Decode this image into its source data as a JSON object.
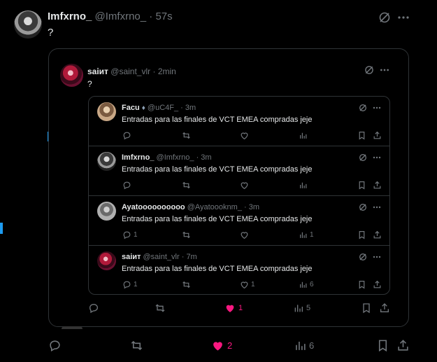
{
  "tweet": {
    "display_name": "Imfxrno_",
    "handle": "@Imfxrno_",
    "time": "· 57s",
    "text": "?",
    "actions": {
      "replies": "",
      "retweets": "",
      "likes": "2",
      "views": "6"
    }
  },
  "quote": {
    "display_name": "saiит",
    "handle": "@saint_vlr",
    "time": "· 2min",
    "text": "?",
    "actions": {
      "replies": "",
      "retweets": "",
      "likes": "1",
      "views": "5"
    }
  },
  "replies": [
    {
      "display_name": "Facu",
      "handle": "@uC4F_",
      "time": "· 3m",
      "text": "Entradas para las finales de VCT EMEA compradas jeje",
      "counts": {
        "replies": "",
        "retweets": "",
        "likes": "",
        "views": ""
      }
    },
    {
      "display_name": "Imfxrno_",
      "handle": "@Imfxrno_",
      "time": "· 3m",
      "text": "Entradas para las finales de VCT EMEA compradas jeje",
      "counts": {
        "replies": "",
        "retweets": "",
        "likes": "",
        "views": ""
      }
    },
    {
      "display_name": "Ayatoooooooooo",
      "handle": "@Ayatoooknm_",
      "time": "· 3m",
      "text": "Entradas para las finales de VCT EMEA compradas jeje",
      "counts": {
        "replies": "1",
        "retweets": "",
        "likes": "",
        "views": "1"
      }
    },
    {
      "display_name": "saiит",
      "handle": "@saint_vlr",
      "time": "· 7m",
      "text": "Entradas para las finales de VCT EMEA compradas jeje",
      "counts": {
        "replies": "1",
        "retweets": "",
        "likes": "1",
        "views": "6"
      }
    }
  ],
  "colors": {
    "like_active": "#f91880",
    "muted": "#71767b",
    "blue_accent": "#1d9bf0"
  }
}
